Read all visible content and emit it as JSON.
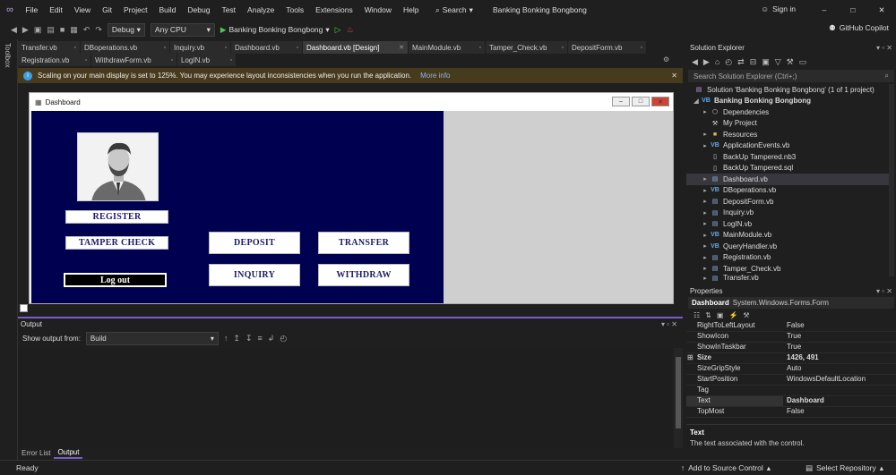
{
  "titlebar": {
    "menu": [
      "File",
      "Edit",
      "View",
      "Git",
      "Project",
      "Build",
      "Debug",
      "Test",
      "Analyze",
      "Tools",
      "Extensions",
      "Window",
      "Help"
    ],
    "search_label": "Search",
    "solution_name": "Banking Bonking Bongbong",
    "sign_in": "Sign in"
  },
  "toolbar": {
    "config": "Debug",
    "platform": "Any CPU",
    "run_label": "Banking Bonking Bongbong",
    "copilot": "GitHub Copilot"
  },
  "toolbox_label": "Toolbox",
  "tabs_row1": [
    {
      "label": "Transfer.vb",
      "active": false
    },
    {
      "label": "DBoperations.vb",
      "active": false
    },
    {
      "label": "Inquiry.vb",
      "active": false
    },
    {
      "label": "Dashboard.vb",
      "active": false
    },
    {
      "label": "Dashboard.vb [Design]",
      "active": true
    },
    {
      "label": "MainModule.vb",
      "active": false
    },
    {
      "label": "Tamper_Check.vb",
      "active": false
    },
    {
      "label": "DepositForm.vb",
      "active": false
    }
  ],
  "tabs_row2": [
    {
      "label": "Registration.vb"
    },
    {
      "label": "WithdrawForm.vb"
    },
    {
      "label": "LogIN.vb"
    }
  ],
  "infobar": {
    "message": "Scaling on your main display is set to 125%. You may experience layout inconsistencies when you run the application.",
    "link": "More info"
  },
  "form": {
    "title": "Dashboard",
    "buttons": {
      "register": "REGISTER",
      "tamper": "TAMPER CHECK",
      "deposit": "DEPOSIT",
      "transfer": "TRANSFER",
      "inquiry": "INQUIRY",
      "withdraw": "WITHDRAW",
      "logout": "Log out"
    },
    "colors": {
      "panel": "#000050",
      "button_text": "#1b1b6b"
    }
  },
  "output": {
    "title": "Output",
    "show_from_label": "Show output from:",
    "source": "Build",
    "bottom_tabs": [
      "Error List",
      "Output"
    ]
  },
  "solution_explorer": {
    "title": "Solution Explorer",
    "search_placeholder": "Search Solution Explorer (Ctrl+;)",
    "items": [
      {
        "label": "Solution 'Banking Bonking Bongbong' (1 of 1 project)",
        "icon": "solution-icon"
      },
      {
        "label": "Banking Bonking Bongbong",
        "icon": "vb-project-icon"
      },
      {
        "label": "Dependencies",
        "icon": "dependencies-icon"
      },
      {
        "label": "My Project",
        "icon": "wrench-icon"
      },
      {
        "label": "Resources",
        "icon": "folder-icon"
      },
      {
        "label": "ApplicationEvents.vb",
        "icon": "vb-file-icon"
      },
      {
        "label": "BackUp Tampered.nb3",
        "icon": "file-icon"
      },
      {
        "label": "BackUp Tampered.sql",
        "icon": "sql-file-icon"
      },
      {
        "label": "Dashboard.vb",
        "icon": "form-icon"
      },
      {
        "label": "DBoperations.vb",
        "icon": "vb-file-icon"
      },
      {
        "label": "DepositForm.vb",
        "icon": "form-icon"
      },
      {
        "label": "Inquiry.vb",
        "icon": "form-icon"
      },
      {
        "label": "LogIN.vb",
        "icon": "form-icon"
      },
      {
        "label": "MainModule.vb",
        "icon": "vb-file-icon"
      },
      {
        "label": "QueryHandler.vb",
        "icon": "vb-file-icon"
      },
      {
        "label": "Registration.vb",
        "icon": "form-icon"
      },
      {
        "label": "Tamper_Check.vb",
        "icon": "form-icon"
      },
      {
        "label": "Transfer.vb",
        "icon": "form-icon"
      }
    ]
  },
  "properties": {
    "title": "Properties",
    "object_name": "Dashboard",
    "object_type": "System.Windows.Forms.Form",
    "rows": [
      {
        "key": "RightToLeftLayout",
        "value": "False"
      },
      {
        "key": "ShowIcon",
        "value": "True"
      },
      {
        "key": "ShowInTaskbar",
        "value": "True"
      },
      {
        "key": "Size",
        "value": "1426, 491"
      },
      {
        "key": "SizeGripStyle",
        "value": "Auto"
      },
      {
        "key": "StartPosition",
        "value": "WindowsDefaultLocation"
      },
      {
        "key": "Tag",
        "value": ""
      },
      {
        "key": "Text",
        "value": "Dashboard"
      },
      {
        "key": "TopMost",
        "value": "False"
      }
    ],
    "desc_title": "Text",
    "desc_text": "The text associated with the control."
  },
  "statusbar": {
    "ready": "Ready",
    "source_control": "Add to Source Control",
    "repository": "Select Repository"
  }
}
